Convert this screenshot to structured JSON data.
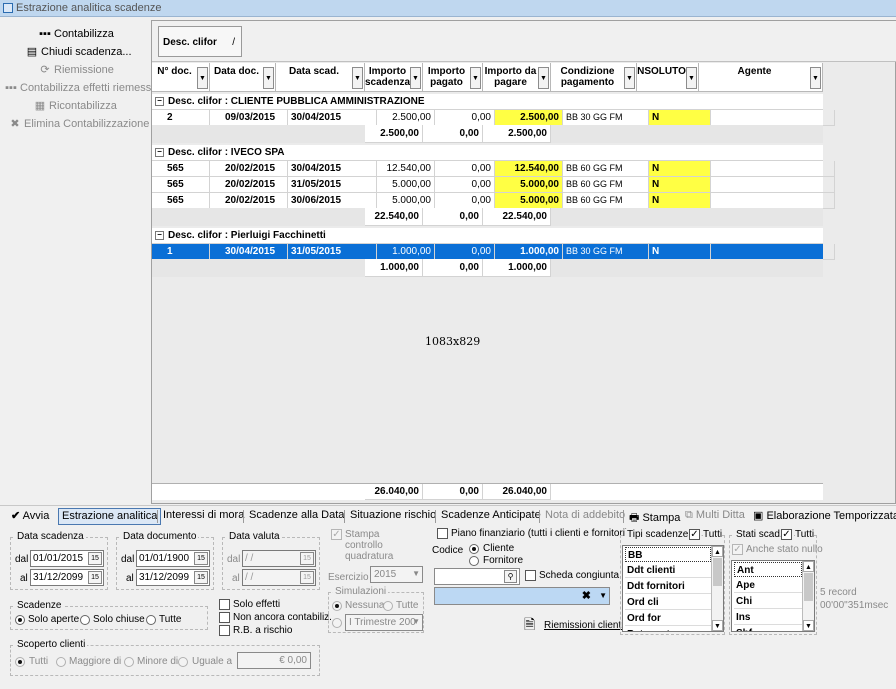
{
  "window": {
    "title": "Estrazione analitica scadenze"
  },
  "toolbar": {
    "items": [
      {
        "label": "Contabilizza",
        "icon": "contabilizza-icon",
        "glyph": "▪▪▪",
        "enabled": true
      },
      {
        "label": "Chiudi scadenza...",
        "icon": "chiudi-scadenza-icon",
        "glyph": "▤",
        "enabled": true
      },
      {
        "label": "Riemissione",
        "icon": "riemissione-icon",
        "glyph": "⟳",
        "enabled": false
      },
      {
        "label": "Contabilizza effetti riemessi",
        "icon": "contabilizza-riemessi-icon",
        "glyph": "▪▪▪",
        "enabled": false
      },
      {
        "label": "Ricontabilizza",
        "icon": "ricontabilizza-icon",
        "glyph": "▦",
        "enabled": false
      },
      {
        "label": "Elimina Contabilizzazione",
        "icon": "elimina-icon",
        "glyph": "✖",
        "enabled": false
      }
    ]
  },
  "grid": {
    "group_by": "Desc. clifor",
    "group_sort": "/",
    "columns": [
      "N° doc.",
      "Data doc.",
      "Data scad.",
      "Importo scadenza",
      "Importo pagato",
      "Importo da pagare",
      "Condizione pagamento",
      "NSOLUTO",
      "Agente"
    ],
    "groups": [
      {
        "title": "Desc. clifor : CLIENTE PUBBLICA AMMINISTRAZIONE",
        "rows": [
          {
            "ndoc": "2",
            "datadoc": "09/03/2015",
            "datascad": "30/04/2015",
            "importo": "2.500,00",
            "pagato": "0,00",
            "dapagare": "2.500,00",
            "condizione": "BB 30 GG FM",
            "insoluto": "N",
            "agente": ""
          }
        ],
        "subtotal": {
          "importo": "2.500,00",
          "pagato": "0,00",
          "dapagare": "2.500,00"
        }
      },
      {
        "title": "Desc. clifor : IVECO SPA",
        "rows": [
          {
            "ndoc": "565",
            "datadoc": "20/02/2015",
            "datascad": "30/04/2015",
            "importo": "12.540,00",
            "pagato": "0,00",
            "dapagare": "12.540,00",
            "condizione": "BB 60 GG FM",
            "insoluto": "N",
            "agente": ""
          },
          {
            "ndoc": "565",
            "datadoc": "20/02/2015",
            "datascad": "31/05/2015",
            "importo": "5.000,00",
            "pagato": "0,00",
            "dapagare": "5.000,00",
            "condizione": "BB 60 GG FM",
            "insoluto": "N",
            "agente": ""
          },
          {
            "ndoc": "565",
            "datadoc": "20/02/2015",
            "datascad": "30/06/2015",
            "importo": "5.000,00",
            "pagato": "0,00",
            "dapagare": "5.000,00",
            "condizione": "BB 60 GG FM",
            "insoluto": "N",
            "agente": ""
          }
        ],
        "subtotal": {
          "importo": "22.540,00",
          "pagato": "0,00",
          "dapagare": "22.540,00"
        }
      },
      {
        "title": "Desc. clifor : Pierluigi Facchinetti",
        "rows": [
          {
            "ndoc": "1",
            "datadoc": "30/04/2015",
            "datascad": "31/05/2015",
            "importo": "1.000,00",
            "pagato": "0,00",
            "dapagare": "1.000,00",
            "condizione": "BB 30 GG FM",
            "insoluto": "N",
            "agente": ""
          }
        ],
        "subtotal": {
          "importo": "1.000,00",
          "pagato": "0,00",
          "dapagare": "1.000,00"
        }
      }
    ],
    "selected_row": "565-none",
    "total": {
      "importo": "26.040,00",
      "pagato": "0,00",
      "dapagare": "26.040,00"
    },
    "size_label": "1083x829"
  },
  "tabs": {
    "run": "Avvia",
    "items": [
      "Estrazione analitica",
      "Interessi di mora",
      "Scadenze alla Data",
      "Situazione rischio",
      "Scadenze Anticipate",
      "Nota di addebito"
    ],
    "stampa": "Stampa",
    "multi_ditta": "Multi Ditta",
    "elab": "Elaborazione Temporizzata"
  },
  "filters": {
    "data_scadenza": {
      "legend": "Data scadenza",
      "dal_label": "dal",
      "al_label": "al",
      "dal": "01/01/2015",
      "al": "31/12/2099"
    },
    "data_documento": {
      "legend": "Data documento",
      "dal_label": "dal",
      "al_label": "al",
      "dal": "01/01/1900",
      "al": "31/12/2099"
    },
    "data_valuta": {
      "legend": "Data valuta",
      "dal_label": "dal",
      "al_label": "al",
      "dal": " / /",
      "al": " / /"
    },
    "scadenze": {
      "legend": "Scadenze",
      "options": [
        "Solo aperte",
        "Solo chiuse",
        "Tutte"
      ],
      "selected": "Solo aperte"
    },
    "checks": [
      "Solo effetti",
      "Non ancora contabiliz.",
      "R.B. a rischio"
    ],
    "scoperto": {
      "legend": "Scoperto clienti",
      "options": [
        "Tutti",
        "Maggiore di",
        "Minore di",
        "Uguale a"
      ],
      "value": "€ 0,00"
    },
    "stampa_controllo": "Stampa controllo quadratura",
    "esercizio_label": "Esercizio",
    "esercizio": "2015",
    "simulazioni": {
      "legend": "Simulazioni",
      "options": [
        "Nessuna",
        "Tutte"
      ],
      "periodo": "I Trimestre 200"
    },
    "piano": "Piano finanziario  (tutti i clienti e fornitori)",
    "codice_label": "Codice",
    "codice_options": [
      "Cliente",
      "Fornitore"
    ],
    "scheda_congiunta": "Scheda congiunta",
    "riemissioni": "Riemissioni clienti",
    "tipi": {
      "legend": "Tipi scadenze",
      "tutti": "Tutti",
      "items": [
        "BB",
        "Ddt clienti",
        "Ddt fornitori",
        "Ord cli",
        "Ord for",
        "Rate mutuo"
      ]
    },
    "stati": {
      "legend": "Stati scad.",
      "tutti": "Tutti",
      "anche": "Anche stato nullo",
      "items": [
        "Ant",
        "Ape",
        "Chi",
        "Ins",
        "Sbf"
      ]
    },
    "records": "5 record",
    "timing": "00'00\"351msec"
  }
}
